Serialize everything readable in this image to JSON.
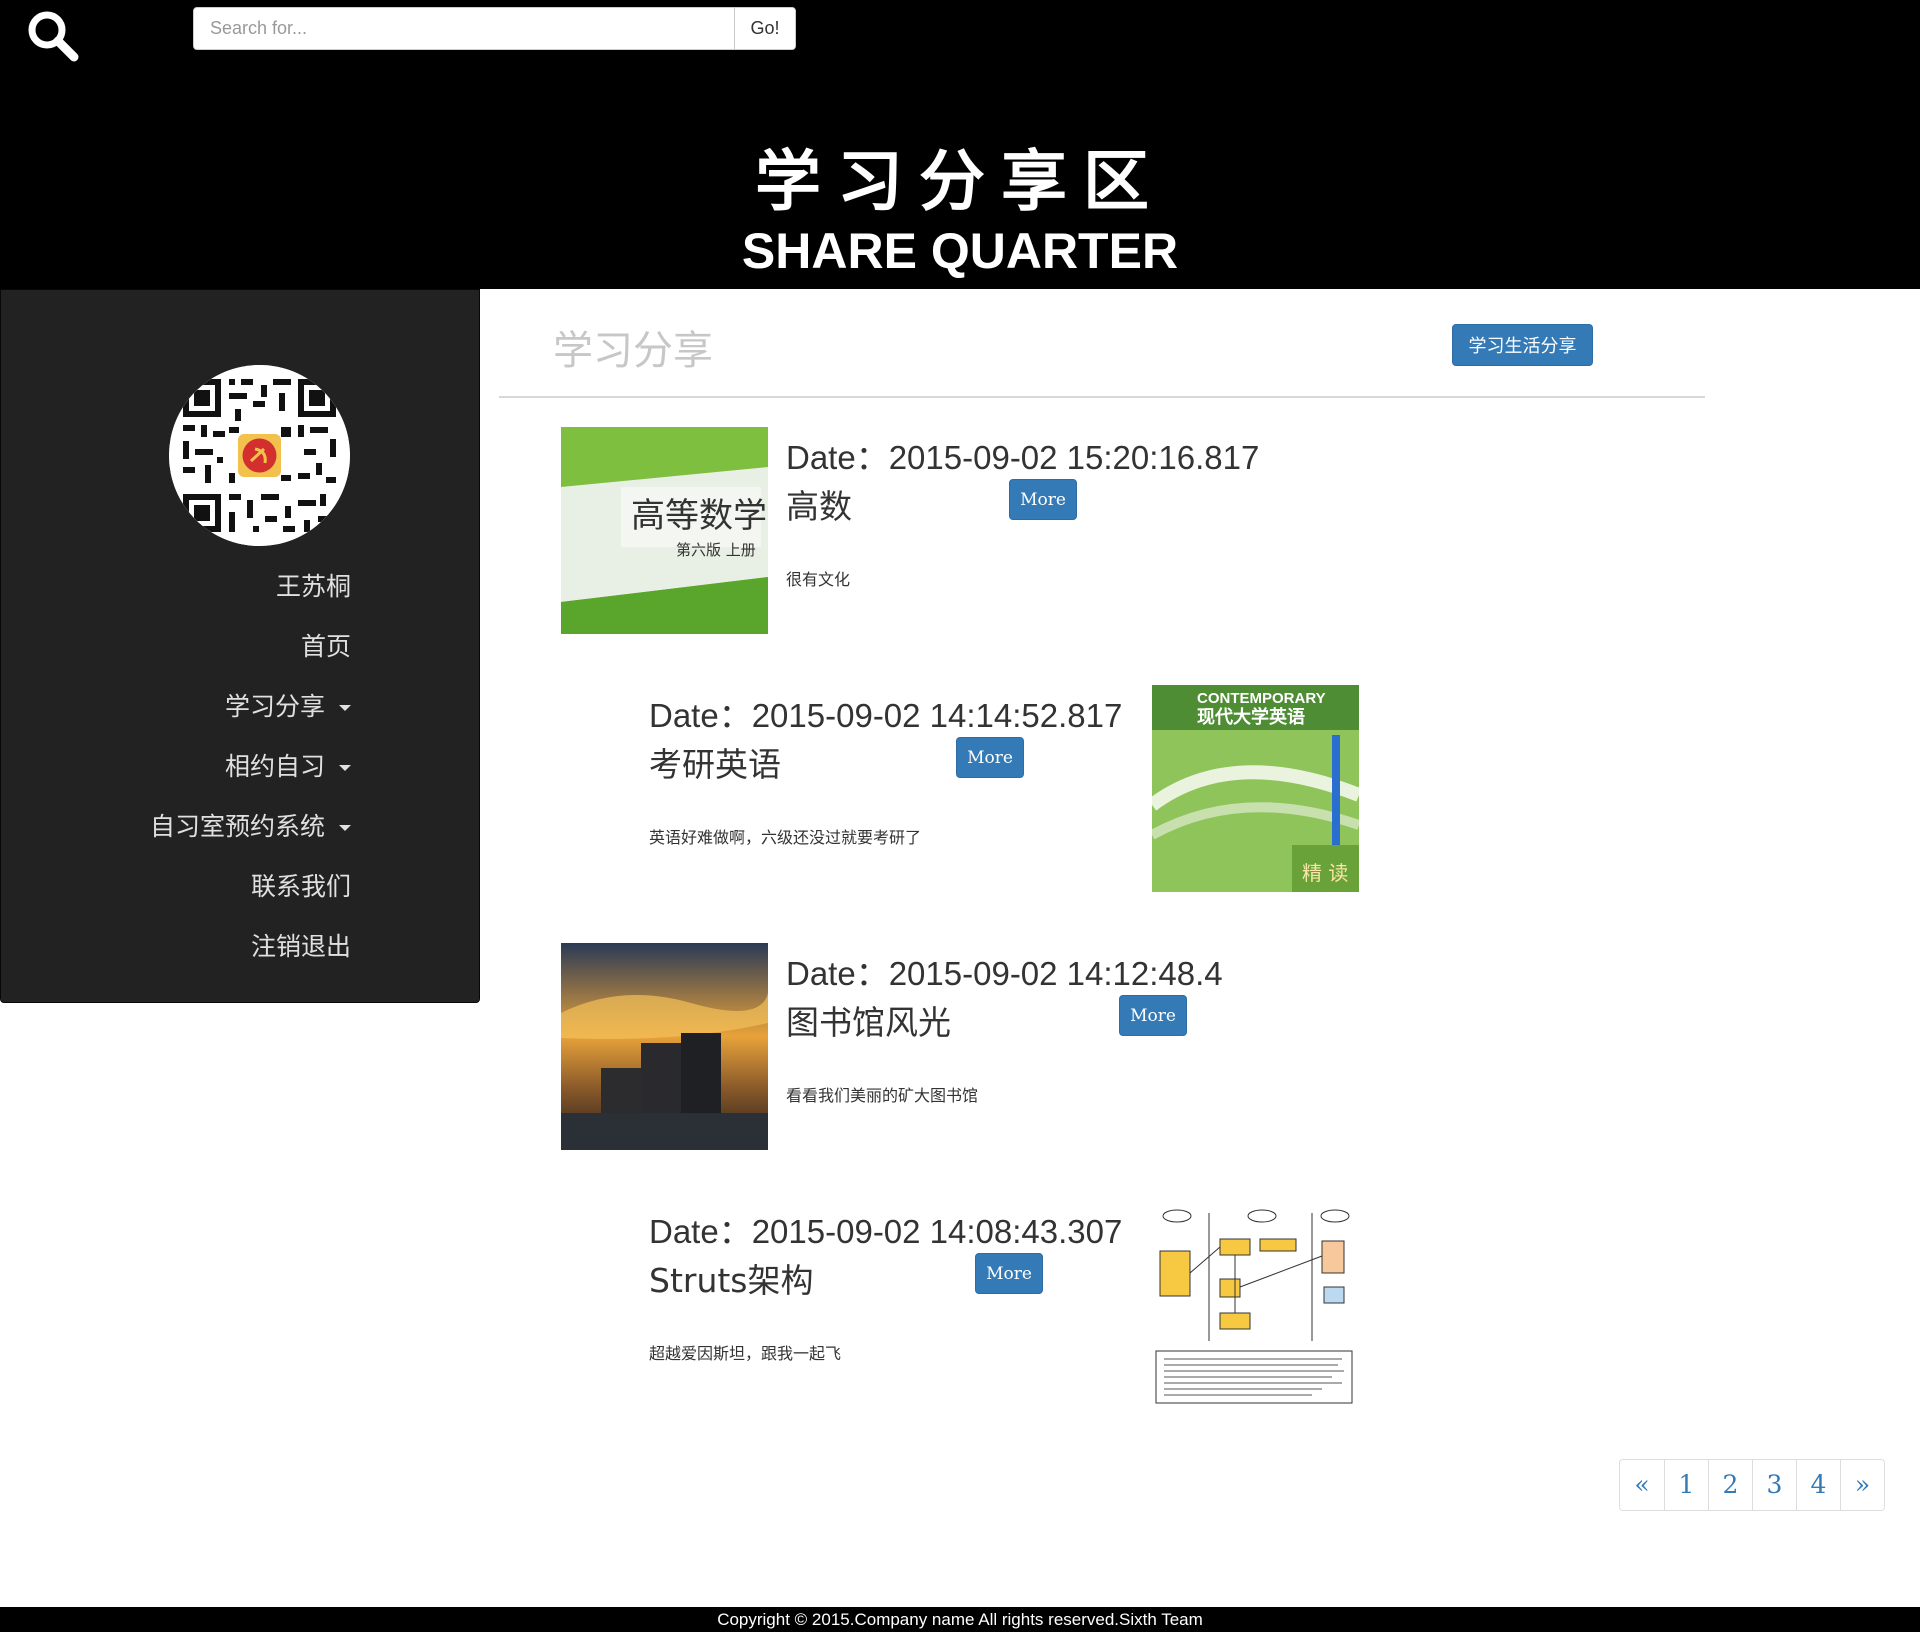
{
  "header": {
    "search_placeholder": "Search for...",
    "search_button": "Go!",
    "title": "学习分享区",
    "subtitle": "SHARE QUARTER"
  },
  "sidebar": {
    "avatar_icon": "qr-code-icon",
    "username": "王苏桐",
    "items": [
      {
        "label": "首页",
        "has_dropdown": false
      },
      {
        "label": "学习分享",
        "has_dropdown": true
      },
      {
        "label": "相约自习",
        "has_dropdown": true
      },
      {
        "label": "自习室预约系统",
        "has_dropdown": true
      },
      {
        "label": "联系我们",
        "has_dropdown": false
      },
      {
        "label": "注销退出",
        "has_dropdown": false
      }
    ]
  },
  "main": {
    "section_title": "学习分享",
    "share_button": "学习生活分享",
    "more_label": "More",
    "posts": [
      {
        "date": "Date：2015-09-02 15:20:16.817",
        "title": "高数",
        "description": "很有文化"
      },
      {
        "date": "Date：2015-09-02 14:14:52.817",
        "title": "考研英语",
        "description": "英语好难做啊，六级还没过就要考研了"
      },
      {
        "date": "Date：2015-09-02 14:12:48.4",
        "title": "图书馆风光",
        "description": "看看我们美丽的矿大图书馆"
      },
      {
        "date": "Date：2015-09-02 14:08:43.307",
        "title": "Struts架构",
        "description": "超越爱因斯坦，跟我一起飞"
      }
    ]
  },
  "pagination": {
    "prev": "«",
    "pages": [
      "1",
      "2",
      "3",
      "4"
    ],
    "next": "»"
  },
  "footer": {
    "text": "Copyright © 2015.Company name All rights reserved.Sixth Team"
  },
  "colors": {
    "header_bg": "#000000",
    "sidebar_bg": "#222222",
    "primary": "#337ab7",
    "link": "#337ab7"
  }
}
